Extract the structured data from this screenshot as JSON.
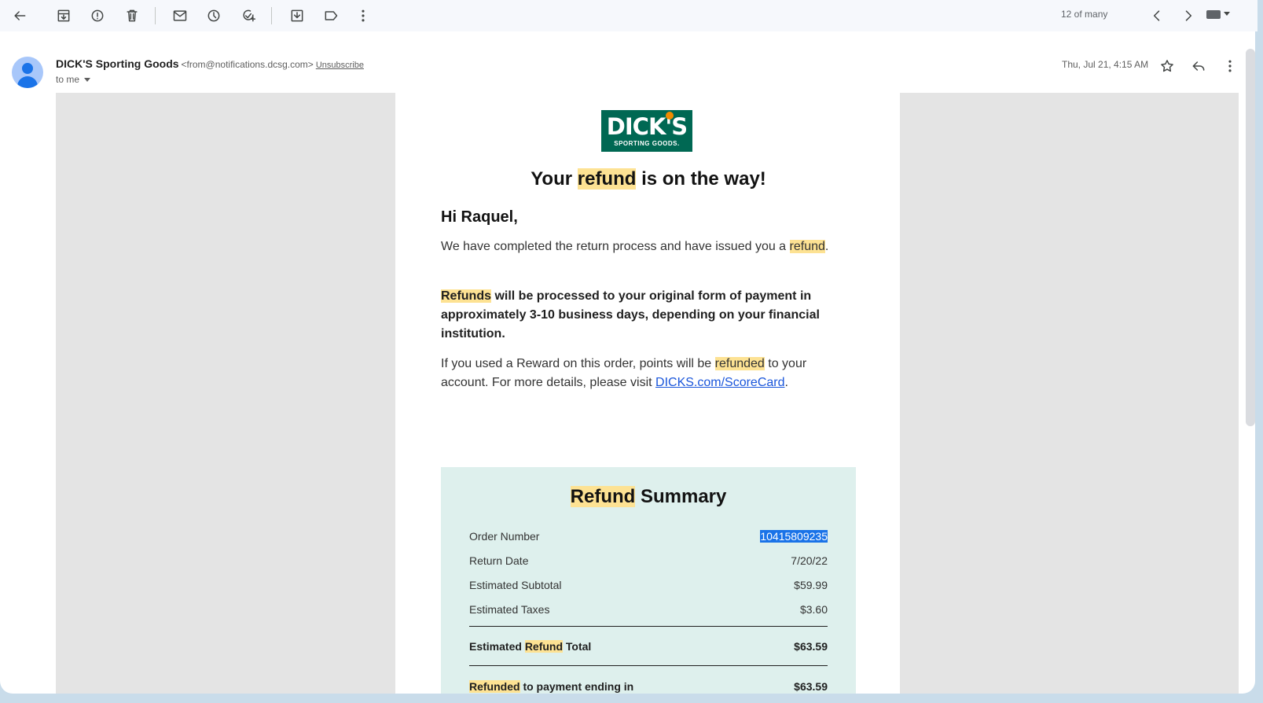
{
  "toolbar": {
    "icons": [
      "back-icon",
      "archive-icon",
      "report-spam-icon",
      "delete-icon",
      "mark-unread-icon",
      "snooze-icon",
      "add-task-icon",
      "move-to-icon",
      "label-icon",
      "more-vert-icon",
      "newer-icon",
      "older-icon",
      "keyboard-icon"
    ],
    "pager": "12 of many"
  },
  "email": {
    "sender_name": "DICK'S Sporting Goods",
    "sender_address": "<from@notifications.dcsg.com>",
    "unsubscribe": "Unsubscribe",
    "to": "to me",
    "date": "Thu, Jul 21, 4:15 AM"
  },
  "newsletter": {
    "logo_line1": "DICK'S",
    "logo_line2": "SPORTING GOODS.",
    "headline_pre": "Your ",
    "headline_hl": "refund",
    "headline_post": " is on the way!",
    "greeting": "Hi Raquel,",
    "p1_text": "We have completed the return process and have issued you a ",
    "p1_hl": "refund",
    "p1_end": ".",
    "p2_hl": "Refunds",
    "p2_text": " will be processed to your original form of payment in approximately 3-10 business days, depending on your financial institution.",
    "p3_pre": "If you used a Reward on this order, points will be ",
    "p3_hl": "refunded",
    "p3_mid": " to your account. For more details, please visit ",
    "p3_link": "DICKS.com/ScoreCard",
    "p3_end": "."
  },
  "summary": {
    "title_hl": "Refund",
    "title_rest": " Summary",
    "rows": [
      {
        "label": "Order Number",
        "value": "10415809235"
      },
      {
        "label": "Return Date",
        "value": "7/20/22"
      },
      {
        "label": "Estimated Subtotal",
        "value": "$59.99"
      },
      {
        "label": "Estimated Taxes",
        "value": "$3.60"
      }
    ],
    "total_pre": "Estimated ",
    "total_hl": "Refund",
    "total_post": " Total",
    "total_value": "$63.59",
    "refunded_hl": "Refunded",
    "refunded_text": " to payment ending in",
    "refunded_value": "$63.59"
  },
  "colors": {
    "brand_green": "#006853",
    "summary_bg": "#def0ed",
    "highlight": "#fde293",
    "selection": "#1a73e8"
  }
}
